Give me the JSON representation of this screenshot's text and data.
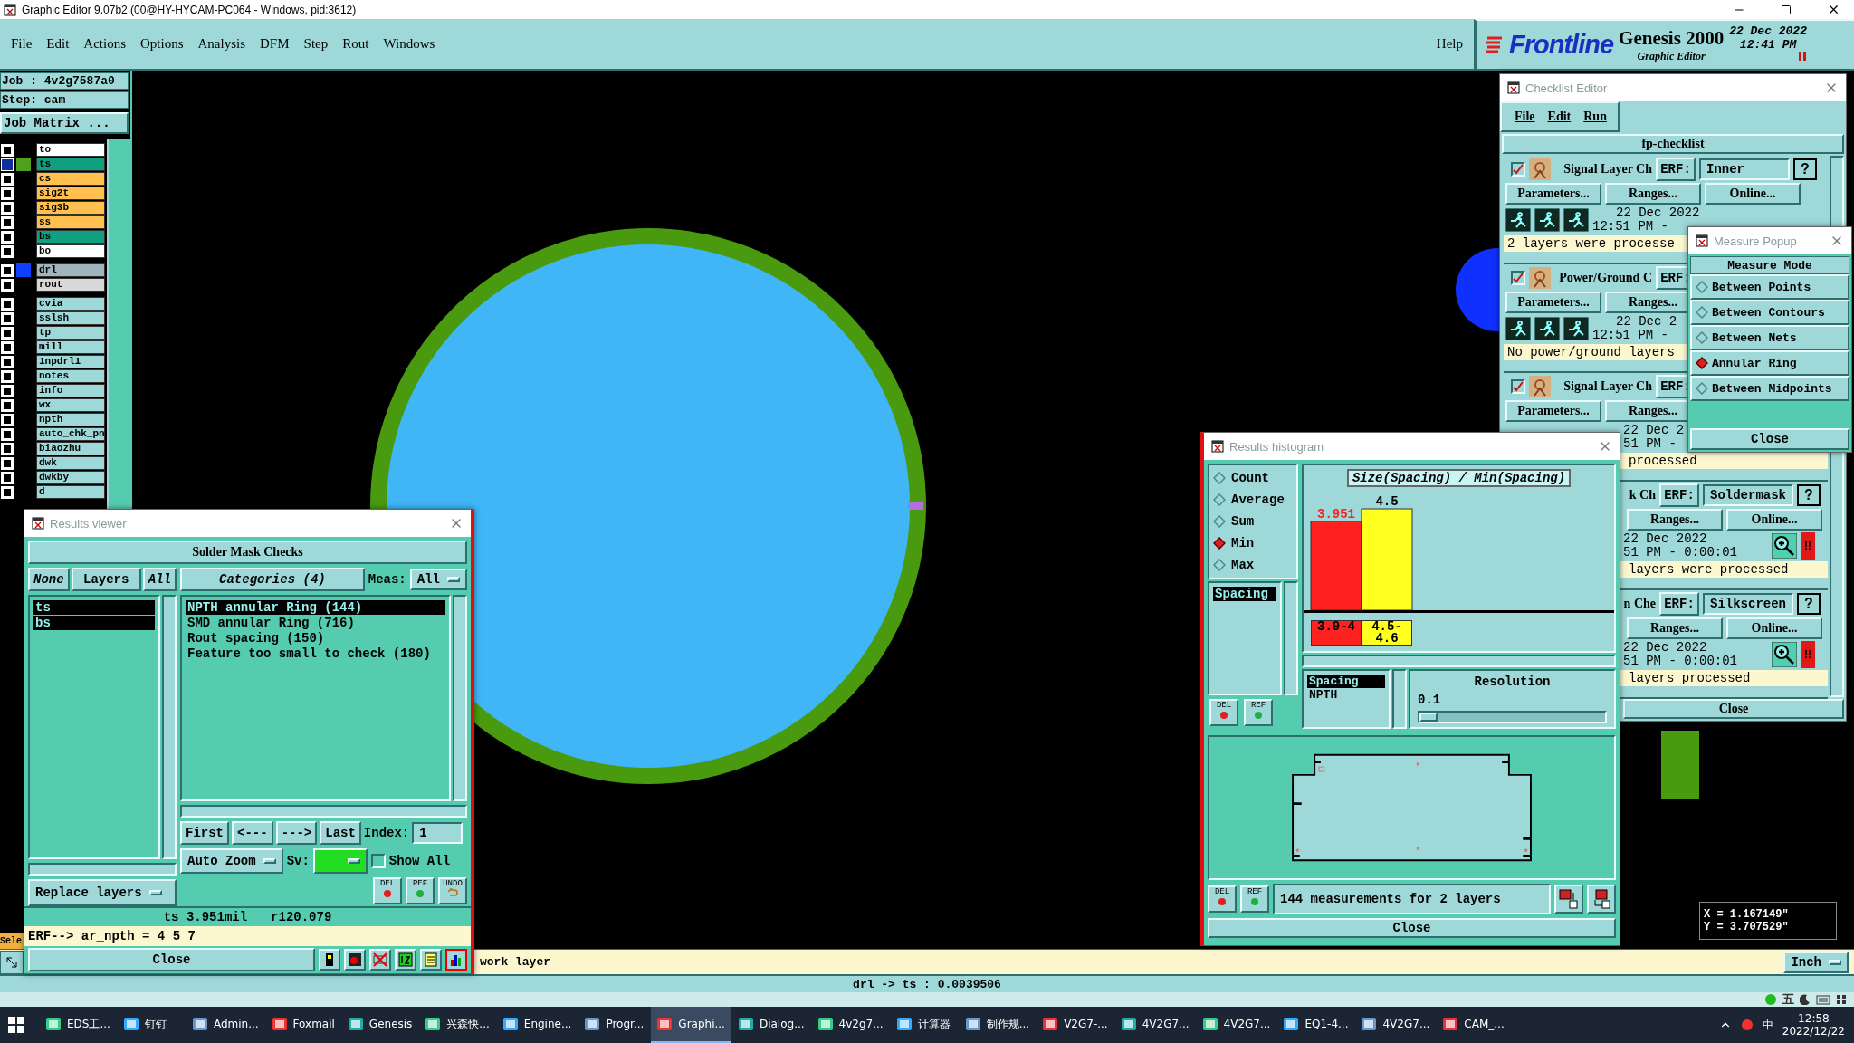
{
  "window": {
    "title": "Graphic Editor 9.07b2 (00@HY-HYCAM-PC064 - Windows, pid:3612)"
  },
  "menu": [
    "File",
    "Edit",
    "Actions",
    "Options",
    "Analysis",
    "DFM",
    "Step",
    "Rout",
    "Windows"
  ],
  "help": "Help",
  "brand": {
    "logo": "Frontline",
    "product": "Genesis 2000",
    "subtitle": "Graphic Editor",
    "date": "22 Dec 2022",
    "time": "12:41 PM"
  },
  "job": {
    "job": "Job : 4v2g7587a0",
    "step": "Step: cam",
    "matrix_button": "Job Matrix ..."
  },
  "layer_groups": [
    {
      "layers": [
        {
          "name": "to",
          "color": "#ffffff",
          "selected": false
        },
        {
          "name": "ts",
          "color": "#10a080",
          "selected": true,
          "swatch": {
            "color": "#50a020"
          }
        },
        {
          "name": "cs",
          "color": "#ffc050",
          "selected": false
        },
        {
          "name": "sig2t",
          "color": "#ffc050",
          "selected": false
        },
        {
          "name": "sig3b",
          "color": "#ffc050",
          "selected": false
        },
        {
          "name": "ss",
          "color": "#ffc050",
          "selected": false
        },
        {
          "name": "bs",
          "color": "#10a080",
          "selected": false
        },
        {
          "name": "bo",
          "color": "#ffffff",
          "selected": false
        }
      ]
    },
    {
      "layers": [
        {
          "name": "drl",
          "color": "#a0b4bc",
          "selected": false,
          "swatch": {
            "color": "#1040ff"
          }
        },
        {
          "name": "rout",
          "color": "#d8d8d8",
          "selected": false
        }
      ]
    },
    {
      "layers": [
        {
          "name": "cvia",
          "color": "#9ed8d8",
          "selected": false
        },
        {
          "name": "sslsh",
          "color": "#9ed8d8",
          "selected": false
        },
        {
          "name": "tp",
          "color": "#9ed8d8",
          "selected": false
        },
        {
          "name": "mill",
          "color": "#9ed8d8",
          "selected": false
        },
        {
          "name": "1npdrl1",
          "color": "#9ed8d8",
          "selected": false
        },
        {
          "name": "notes",
          "color": "#9ed8d8",
          "selected": false
        },
        {
          "name": "info",
          "color": "#9ed8d8",
          "selected": false
        },
        {
          "name": "wx",
          "color": "#9ed8d8",
          "selected": false
        },
        {
          "name": "npth",
          "color": "#9ed8d8",
          "selected": false
        },
        {
          "name": "auto_chk_pn",
          "color": "#9ed8d8",
          "selected": false
        },
        {
          "name": "biaozhu",
          "color": "#9ed8d8",
          "selected": false
        },
        {
          "name": "dwk",
          "color": "#9ed8d8",
          "selected": false
        },
        {
          "name": "dwkby",
          "color": "#9ed8d8",
          "selected": false
        },
        {
          "name": "d",
          "color": "#9ed8d8",
          "selected": false
        }
      ]
    }
  ],
  "sele": "Sele",
  "results_viewer": {
    "title": "Results viewer",
    "heading": "Solder Mask Checks",
    "layer_buttons": [
      "None",
      "Layers",
      "All"
    ],
    "layers": [
      {
        "name": "ts",
        "selected": true
      },
      {
        "name": "bs",
        "selected": true
      }
    ],
    "categories_button": "Categories (4)",
    "meas_label": "Meas:",
    "meas_value": "All",
    "categories": [
      {
        "label": "NPTH annular Ring (144)",
        "selected": true
      },
      {
        "label": "SMD annular Ring (716)",
        "selected": false
      },
      {
        "label": "Rout spacing (150)",
        "selected": false
      },
      {
        "label": "Feature too small to check (180)",
        "selected": false
      }
    ],
    "nav": [
      "First",
      "<---",
      "--->",
      "Last"
    ],
    "index_label": "Index:",
    "index_value": "1",
    "zoom_mode": "Auto Zoom",
    "sv_label": "Sv:",
    "show_all": {
      "label": "Show All",
      "checked": false
    },
    "replace": "Replace layers",
    "tools": [
      "DEL",
      "REF",
      "UNDO"
    ],
    "status": [
      "ts 3.951mil",
      "r120.079"
    ],
    "erf": "ERF--> ar_npth = 4 5 7",
    "close": "Close"
  },
  "message": "work layer",
  "units": "Inch",
  "status_line": "drl -> ts : 0.0039506",
  "coordinates": [
    "X = 1.167149\"",
    "Y = 3.707529\""
  ],
  "histogram": {
    "title": "Results histogram",
    "modes": [
      {
        "label": "Count",
        "selected": false
      },
      {
        "label": "Average",
        "selected": false
      },
      {
        "label": "Sum",
        "selected": false
      },
      {
        "label": "Min",
        "selected": true
      },
      {
        "label": "Max",
        "selected": false
      }
    ],
    "attributes": [
      {
        "label": "Spacing",
        "selected": true
      }
    ],
    "tools": [
      "DEL",
      "REF"
    ],
    "chart_data": {
      "type": "bar",
      "title": "Size(Spacing) / Min(Spacing)",
      "categories": [
        "3.9-4",
        "4.5-4.6"
      ],
      "series": [
        {
          "color": "#ff2020",
          "values": [
            3.951,
            null
          ]
        },
        {
          "color": "#ffff20",
          "values": [
            null,
            4.5
          ]
        }
      ],
      "data_labels": true
    },
    "fields": [
      {
        "label": "Spacing",
        "selected": true
      },
      {
        "label": "NPTH",
        "selected": false
      }
    ],
    "resolution": {
      "label": "Resolution",
      "value": "0.1",
      "level": 0.06
    },
    "bottom_tools": [
      "DEL",
      "REF"
    ],
    "summary": "144 measurements for 2 layers",
    "close": "Close"
  },
  "checklist": {
    "title": "Checklist Editor",
    "menu": [
      "File",
      "Edit",
      "Run"
    ],
    "name": "fp-checklist",
    "items": [
      {
        "checked": true,
        "name": "Signal Layer Ch",
        "erf_label": "ERF:",
        "erf": "Inner",
        "help": "?",
        "buttons": [
          "Parameters...",
          "Ranges...",
          "Online..."
        ],
        "run_icons": true,
        "date": "22 Dec 2022",
        "time": "12:51 PM -",
        "message": "2 layers were processe"
      },
      {
        "checked": true,
        "name": "Power/Ground C",
        "erf_label": "ERF:",
        "buttons": [
          "Parameters...",
          "Ranges..."
        ],
        "run_icons": true,
        "date": "22 Dec 2",
        "time": "12:51 PM -",
        "message": "No power/ground layers"
      },
      {
        "checked": true,
        "name": "Signal Layer Ch",
        "erf_label": "ERF:",
        "buttons": [
          "Parameters...",
          "Ranges..."
        ],
        "date": "22 Dec 2",
        "time": "51 PM -",
        "message": "processed"
      },
      {
        "name": "k Ch",
        "erf_label": "ERF:",
        "erf": "Soldermask",
        "help": "?",
        "buttons": [
          "Ranges...",
          "Online..."
        ],
        "date": "22 Dec 2022",
        "time": "51 PM - 0:00:01",
        "zoom": true,
        "alert": "!!",
        "message": "layers were processed"
      },
      {
        "name": "n Che",
        "erf_label": "ERF:",
        "erf": "Silkscreen",
        "help": "?",
        "buttons": [
          "Ranges...",
          "Online..."
        ],
        "date": "22 Dec 2022",
        "time": "51 PM - 0:00:01",
        "zoom": true,
        "alert": "!!",
        "message": "layers processed"
      }
    ],
    "close": "Close"
  },
  "measure_popup": {
    "title": "Measure Popup",
    "heading": "Measure Mode",
    "modes": [
      {
        "label": "Between Points",
        "selected": false
      },
      {
        "label": "Between Contours",
        "selected": false
      },
      {
        "label": "Between Nets",
        "selected": false
      },
      {
        "label": "Annular Ring",
        "selected": true
      },
      {
        "label": "Between Midpoints",
        "selected": false
      }
    ],
    "close": "Close"
  },
  "ime": "五",
  "taskbar": {
    "items": [
      {
        "label": "EDS工...",
        "selected": false
      },
      {
        "label": "钉钉",
        "selected": false
      },
      {
        "label": "Admin...",
        "selected": false
      },
      {
        "label": "Foxmail",
        "selected": false
      },
      {
        "label": "Genesis",
        "selected": false
      },
      {
        "label": "兴森快...",
        "selected": false
      },
      {
        "label": "Engine...",
        "selected": false
      },
      {
        "label": "Progr...",
        "selected": false
      },
      {
        "label": "Graphi...",
        "selected": true
      },
      {
        "label": "Dialog...",
        "selected": false
      },
      {
        "label": "4v2g7...",
        "selected": false
      },
      {
        "label": "计算器",
        "selected": false
      },
      {
        "label": "制作规...",
        "selected": false
      },
      {
        "label": "V2G7-...",
        "selected": false
      },
      {
        "label": "4V2G7...",
        "selected": false
      },
      {
        "label": "4V2G7...",
        "selected": false
      },
      {
        "label": "EQ1-4...",
        "selected": false
      },
      {
        "label": "4V2G7...",
        "selected": false
      },
      {
        "label": "CAM_...",
        "selected": false
      }
    ],
    "input_method": "中",
    "time": "12:58",
    "date": "2022/12/22"
  }
}
